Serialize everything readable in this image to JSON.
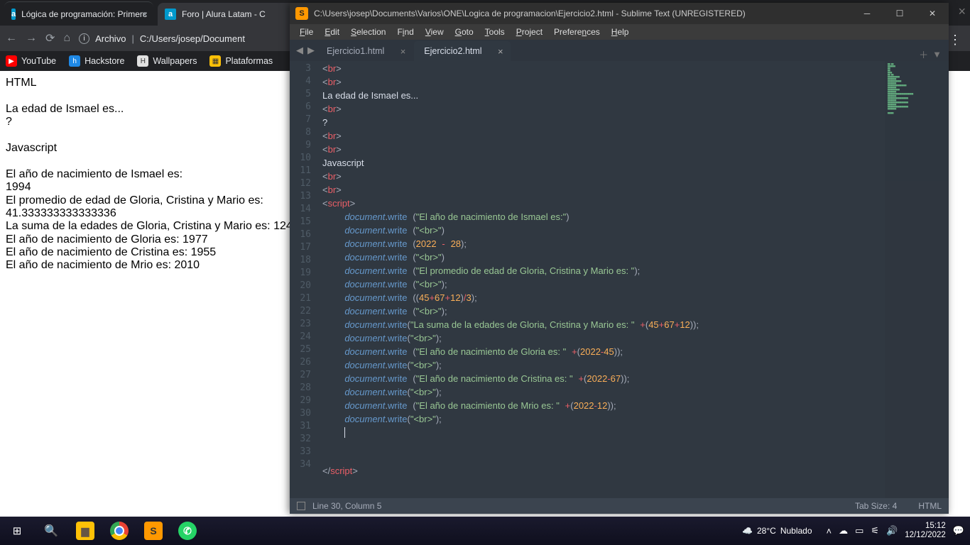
{
  "chrome": {
    "tabs": [
      {
        "favicon": "a",
        "title": "Lógica de programación: Primerc"
      },
      {
        "favicon": "a",
        "title": "Foro | Alura Latam - C"
      }
    ],
    "address_label": "Archivo",
    "address_path": "C:/Users/josep/Document",
    "menu_dots": "⋮",
    "bookmarks": [
      {
        "icon": "▶",
        "color": "#ff0000",
        "label": "YouTube"
      },
      {
        "icon": "h",
        "color": "#1e88e5",
        "label": "Hackstore"
      },
      {
        "icon": "H",
        "color": "#e0e0e0",
        "label": "Wallpapers"
      },
      {
        "icon": "▦",
        "color": "#ffc107",
        "label": "Plataformas"
      }
    ],
    "page": {
      "heading": "HTML",
      "line1": "La edad de Ismael es...",
      "line2": "?",
      "heading2": "Javascript",
      "l3": "El año de nacimiento de Ismael es:",
      "l4": "1994",
      "l5": "El promedio de edad de Gloria, Cristina y Mario es:",
      "l6": "41.333333333333336",
      "l7": "La suma de la edades de Gloria, Cristina y Mario es: 124",
      "l8": "El año de nacimiento de Gloria es: 1977",
      "l9": "El año de nacimiento de Cristina es: 1955",
      "l10": "El año de nacimiento de Mrio es: 2010"
    }
  },
  "sublime": {
    "title": "C:\\Users\\josep\\Documents\\Varios\\ONE\\Logica de programacion\\Ejercicio2.html - Sublime Text (UNREGISTERED)",
    "menus": [
      "File",
      "Edit",
      "Selection",
      "Find",
      "View",
      "Goto",
      "Tools",
      "Project",
      "Preferences",
      "Help"
    ],
    "tabs": [
      {
        "label": "Ejercicio1.html",
        "active": false
      },
      {
        "label": "Ejercicio2.html",
        "active": true
      }
    ],
    "gutter_start": 3,
    "gutter_end": 34,
    "status": {
      "cursor": "Line 30, Column 5",
      "tab_size": "Tab Size: 4",
      "syntax": "HTML"
    },
    "code": {
      "br": "br",
      "l5": "La edad de Ismael es...",
      "l7": "?",
      "l10": "Javascript",
      "script_open": "script",
      "script_close": "script",
      "doc": "document",
      "write": "write",
      "s14": "\"El año de nacimiento de Ismael es:\"",
      "s_br": "\"<br>\"",
      "n2022": "2022",
      "n28": "28",
      "s18": "\"El promedio de edad de Gloria, Cristina y Mario es: \"",
      "n45": "45",
      "n67": "67",
      "n12": "12",
      "n3": "3",
      "s22": "\"La suma de la edades de Gloria, Cristina y Mario es: \"",
      "s24": "\"El año de nacimiento de Gloria es: \"",
      "s26": "\"El año de nacimiento de Cristina es: \"",
      "s28": "\"El año de nacimiento de Mrio es: \""
    }
  },
  "taskbar": {
    "weather_temp": "28°C",
    "weather_cond": "Nublado",
    "time": "15:12",
    "date": "12/12/2022"
  }
}
